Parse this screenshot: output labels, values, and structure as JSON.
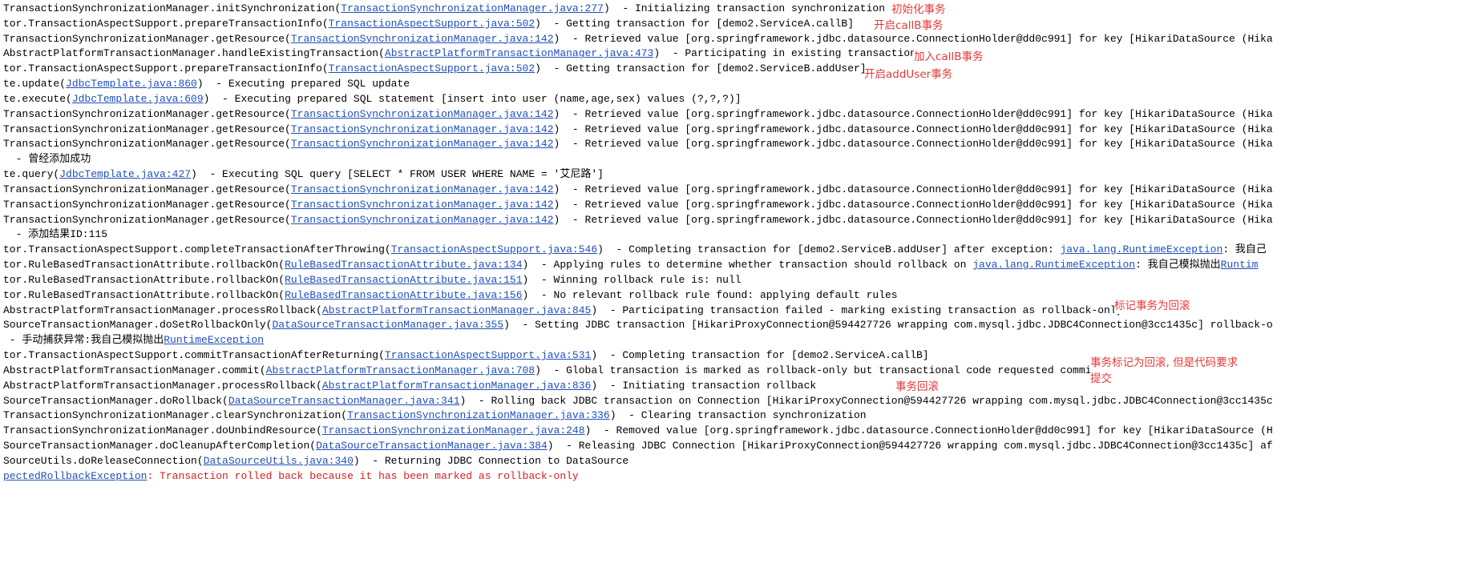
{
  "colors": {
    "text": "#000000",
    "link": "#1f4fb8",
    "error": "#d81e1e",
    "annotation": "#e23b3b"
  },
  "lines": [
    [
      {
        "t": "TransactionSynchronizationManager.initSynchronization("
      },
      {
        "t": "TransactionSynchronizationManager.java:277",
        "k": "link"
      },
      {
        "t": ")  - Initializing transaction synchronization"
      }
    ],
    [
      {
        "t": "tor.TransactionAspectSupport.prepareTransactionInfo("
      },
      {
        "t": "TransactionAspectSupport.java:502",
        "k": "link"
      },
      {
        "t": ")  - Getting transaction for [demo2.ServiceA.callB]"
      }
    ],
    [
      {
        "t": "TransactionSynchronizationManager.getResource("
      },
      {
        "t": "TransactionSynchronizationManager.java:142",
        "k": "link"
      },
      {
        "t": ")  - Retrieved value [org.springframework.jdbc.datasource.ConnectionHolder@dd0c991] for key [HikariDataSource (Hika"
      }
    ],
    [
      {
        "t": "AbstractPlatformTransactionManager.handleExistingTransaction("
      },
      {
        "t": "AbstractPlatformTransactionManager.java:473",
        "k": "link"
      },
      {
        "t": ")  - Participating in existing transaction"
      }
    ],
    [
      {
        "t": "tor.TransactionAspectSupport.prepareTransactionInfo("
      },
      {
        "t": "TransactionAspectSupport.java:502",
        "k": "link"
      },
      {
        "t": ")  - Getting transaction for [demo2.ServiceB.addUser]"
      }
    ],
    [
      {
        "t": "te.update("
      },
      {
        "t": "JdbcTemplate.java:860",
        "k": "link"
      },
      {
        "t": ")  - Executing prepared SQL update"
      }
    ],
    [
      {
        "t": "te.execute("
      },
      {
        "t": "JdbcTemplate.java:609",
        "k": "link"
      },
      {
        "t": ")  - Executing prepared SQL statement [insert into user (name,age,sex) values (?,?,?)]"
      }
    ],
    [
      {
        "t": "TransactionSynchronizationManager.getResource("
      },
      {
        "t": "TransactionSynchronizationManager.java:142",
        "k": "link"
      },
      {
        "t": ")  - Retrieved value [org.springframework.jdbc.datasource.ConnectionHolder@dd0c991] for key [HikariDataSource (Hika"
      }
    ],
    [
      {
        "t": "TransactionSynchronizationManager.getResource("
      },
      {
        "t": "TransactionSynchronizationManager.java:142",
        "k": "link"
      },
      {
        "t": ")  - Retrieved value [org.springframework.jdbc.datasource.ConnectionHolder@dd0c991] for key [HikariDataSource (Hika"
      }
    ],
    [
      {
        "t": "TransactionSynchronizationManager.getResource("
      },
      {
        "t": "TransactionSynchronizationManager.java:142",
        "k": "link"
      },
      {
        "t": ")  - Retrieved value [org.springframework.jdbc.datasource.ConnectionHolder@dd0c991] for key [HikariDataSource (Hika"
      }
    ],
    [
      {
        "t": "  - 曾经添加成功"
      }
    ],
    [
      {
        "t": "te.query("
      },
      {
        "t": "JdbcTemplate.java:427",
        "k": "link"
      },
      {
        "t": ")  - Executing SQL query [SELECT * FROM USER WHERE NAME = '艾尼路']"
      }
    ],
    [
      {
        "t": "TransactionSynchronizationManager.getResource("
      },
      {
        "t": "TransactionSynchronizationManager.java:142",
        "k": "link"
      },
      {
        "t": ")  - Retrieved value [org.springframework.jdbc.datasource.ConnectionHolder@dd0c991] for key [HikariDataSource (Hika"
      }
    ],
    [
      {
        "t": "TransactionSynchronizationManager.getResource("
      },
      {
        "t": "TransactionSynchronizationManager.java:142",
        "k": "link"
      },
      {
        "t": ")  - Retrieved value [org.springframework.jdbc.datasource.ConnectionHolder@dd0c991] for key [HikariDataSource (Hika"
      }
    ],
    [
      {
        "t": "TransactionSynchronizationManager.getResource("
      },
      {
        "t": "TransactionSynchronizationManager.java:142",
        "k": "link"
      },
      {
        "t": ")  - Retrieved value [org.springframework.jdbc.datasource.ConnectionHolder@dd0c991] for key [HikariDataSource (Hika"
      }
    ],
    [
      {
        "t": "  - 添加结果ID:115"
      }
    ],
    [
      {
        "t": "tor.TransactionAspectSupport.completeTransactionAfterThrowing("
      },
      {
        "t": "TransactionAspectSupport.java:546",
        "k": "link"
      },
      {
        "t": ")  - Completing transaction for [demo2.ServiceB.addUser] after exception: "
      },
      {
        "t": "java.lang.RuntimeException",
        "k": "link"
      },
      {
        "t": ": 我自己"
      }
    ],
    [
      {
        "t": "tor.RuleBasedTransactionAttribute.rollbackOn("
      },
      {
        "t": "RuleBasedTransactionAttribute.java:134",
        "k": "link"
      },
      {
        "t": ")  - Applying rules to determine whether transaction should rollback on "
      },
      {
        "t": "java.lang.RuntimeException",
        "k": "link"
      },
      {
        "t": ": 我自己模拟抛出"
      },
      {
        "t": "Runtim",
        "k": "link"
      }
    ],
    [
      {
        "t": "tor.RuleBasedTransactionAttribute.rollbackOn("
      },
      {
        "t": "RuleBasedTransactionAttribute.java:151",
        "k": "link"
      },
      {
        "t": ")  - Winning rollback rule is: null"
      }
    ],
    [
      {
        "t": "tor.RuleBasedTransactionAttribute.rollbackOn("
      },
      {
        "t": "RuleBasedTransactionAttribute.java:156",
        "k": "link"
      },
      {
        "t": ")  - No relevant rollback rule found: applying default rules"
      }
    ],
    [
      {
        "t": "AbstractPlatformTransactionManager.processRollback("
      },
      {
        "t": "AbstractPlatformTransactionManager.java:845",
        "k": "link"
      },
      {
        "t": ")  - Participating transaction failed - marking existing transaction as rollback-only"
      }
    ],
    [
      {
        "t": "SourceTransactionManager.doSetRollbackOnly("
      },
      {
        "t": "DataSourceTransactionManager.java:355",
        "k": "link"
      },
      {
        "t": ")  - Setting JDBC transaction [HikariProxyConnection@594427726 wrapping com.mysql.jdbc.JDBC4Connection@3cc1435c] rollback-o"
      }
    ],
    [
      {
        "t": " - 手动捕获异常:我自己模拟抛出"
      },
      {
        "t": "RuntimeException",
        "k": "link"
      }
    ],
    [
      {
        "t": "tor.TransactionAspectSupport.commitTransactionAfterReturning("
      },
      {
        "t": "TransactionAspectSupport.java:531",
        "k": "link"
      },
      {
        "t": ")  - Completing transaction for [demo2.ServiceA.callB]"
      }
    ],
    [
      {
        "t": "AbstractPlatformTransactionManager.commit("
      },
      {
        "t": "AbstractPlatformTransactionManager.java:708",
        "k": "link"
      },
      {
        "t": ")  - Global transaction is marked as rollback-only but transactional code requested commit"
      }
    ],
    [
      {
        "t": "AbstractPlatformTransactionManager.processRollback("
      },
      {
        "t": "AbstractPlatformTransactionManager.java:836",
        "k": "link"
      },
      {
        "t": ")  - Initiating transaction rollback"
      }
    ],
    [
      {
        "t": "SourceTransactionManager.doRollback("
      },
      {
        "t": "DataSourceTransactionManager.java:341",
        "k": "link"
      },
      {
        "t": ")  - Rolling back JDBC transaction on Connection [HikariProxyConnection@594427726 wrapping com.mysql.jdbc.JDBC4Connection@3cc1435c"
      }
    ],
    [
      {
        "t": "TransactionSynchronizationManager.clearSynchronization("
      },
      {
        "t": "TransactionSynchronizationManager.java:336",
        "k": "link"
      },
      {
        "t": ")  - Clearing transaction synchronization"
      }
    ],
    [
      {
        "t": "TransactionSynchronizationManager.doUnbindResource("
      },
      {
        "t": "TransactionSynchronizationManager.java:248",
        "k": "link"
      },
      {
        "t": ")  - Removed value [org.springframework.jdbc.datasource.ConnectionHolder@dd0c991] for key [HikariDataSource (H"
      }
    ],
    [
      {
        "t": "SourceTransactionManager.doCleanupAfterCompletion("
      },
      {
        "t": "DataSourceTransactionManager.java:384",
        "k": "link"
      },
      {
        "t": ")  - Releasing JDBC Connection [HikariProxyConnection@594427726 wrapping com.mysql.jdbc.JDBC4Connection@3cc1435c] af"
      }
    ],
    [
      {
        "t": "SourceUtils.doReleaseConnection("
      },
      {
        "t": "DataSourceUtils.java:340",
        "k": "link"
      },
      {
        "t": ")  - Returning JDBC Connection to DataSource"
      }
    ],
    [
      {
        "t": "pectedRollbackException",
        "k": "link"
      },
      {
        "t": ": Transaction rolled back because it has been marked as rollback-only",
        "k": "error"
      }
    ]
  ],
  "annotations": {
    "init": "初始化事务",
    "open_callB": "开启callB事务",
    "join_callB": "加入callB事务",
    "open_addUser": "开启addUser事务",
    "mark_rollback": "标记事务为回滚",
    "marked_but_commit": "事务标记为回滚, 但是代码要求\n提交",
    "rollback": "事务回滚"
  }
}
